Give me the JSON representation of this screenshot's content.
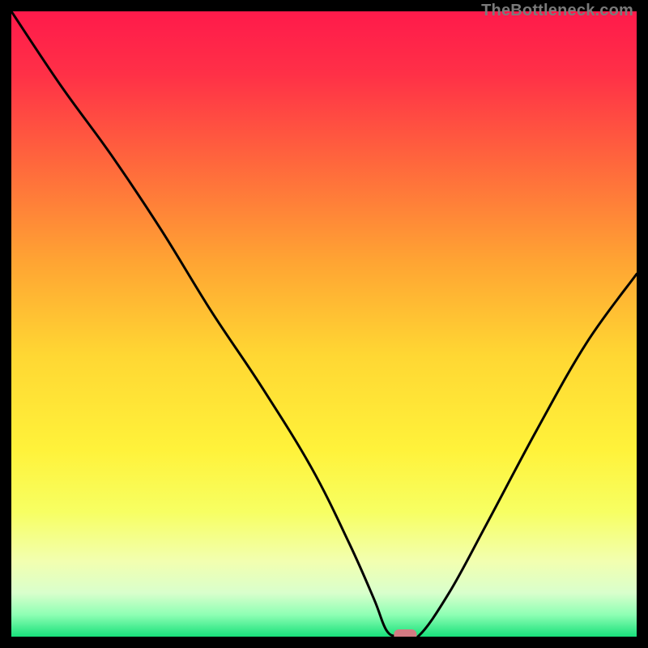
{
  "watermark": "TheBottleneck.com",
  "chart_data": {
    "type": "line",
    "title": "",
    "xlabel": "",
    "ylabel": "",
    "xlim": [
      0,
      100
    ],
    "ylim": [
      0,
      100
    ],
    "grid": false,
    "series": [
      {
        "name": "curve",
        "x": [
          0,
          8,
          16,
          24,
          32,
          40,
          48,
          54,
          58,
          60,
          62,
          65,
          70,
          76,
          84,
          92,
          100
        ],
        "y": [
          100,
          88,
          77,
          65,
          52,
          40,
          27,
          15,
          6,
          1,
          0,
          0,
          7,
          18,
          33,
          47,
          58
        ]
      }
    ],
    "marker": {
      "x": 63,
      "y": 0,
      "color": "#d37a82"
    },
    "gradient_stops": [
      {
        "offset": 0.0,
        "color": "#ff1a4b"
      },
      {
        "offset": 0.1,
        "color": "#ff3047"
      },
      {
        "offset": 0.25,
        "color": "#ff6a3c"
      },
      {
        "offset": 0.4,
        "color": "#ffa433"
      },
      {
        "offset": 0.55,
        "color": "#ffd733"
      },
      {
        "offset": 0.7,
        "color": "#fff23a"
      },
      {
        "offset": 0.8,
        "color": "#f7ff62"
      },
      {
        "offset": 0.88,
        "color": "#f2ffb0"
      },
      {
        "offset": 0.93,
        "color": "#d9ffcc"
      },
      {
        "offset": 0.965,
        "color": "#8effb4"
      },
      {
        "offset": 1.0,
        "color": "#18e07a"
      }
    ]
  }
}
